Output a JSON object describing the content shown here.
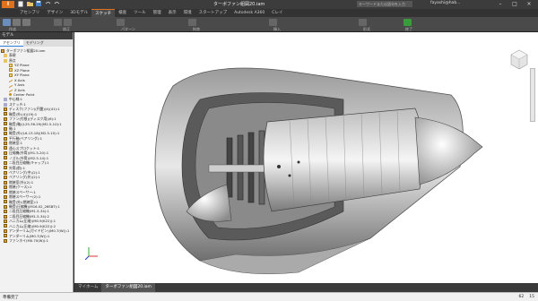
{
  "app": {
    "logo": "I",
    "window_title": "ターボファン組図20.iam",
    "search_placeholder": "キーワードまたは語句を入力",
    "user": "fayashi@hab..."
  },
  "ribbon": {
    "file_tab": "ファイル",
    "tabs": [
      "アセンブリ",
      "デザイン",
      "3Dモデル",
      "スケッチ",
      "検査",
      "ツール",
      "管理",
      "表示",
      "環境",
      "スタートアップ",
      "Autodesk A360",
      "Cレイ"
    ],
    "active_tab": "スケッチ",
    "groups": [
      "作成",
      "修正",
      "パターン",
      "拘束",
      "挿入",
      "形式",
      "終了"
    ]
  },
  "browser": {
    "header": "モデル",
    "tabs": [
      "アセンブリ",
      "モデリング"
    ],
    "items": [
      "ターボファン組図20.iam",
      "表現",
      "原点",
      "YZ Plane",
      "XZ Plane",
      "XY Plane",
      "X Axis",
      "Y Axis",
      "Z Axis",
      "Center Point",
      "中心線:1",
      "スケッチ:1",
      "ディスク(ファン)(円盤)(4)(41):1",
      "軸受(外)(4)(19):1",
      "ファン(付根)(ディスク用)(6):1",
      "軸受(軸)(L25-36.29)(M2.5-10):1",
      "軸:1",
      "軸受(外)(L6-13.18)(M2.5-10):1",
      "平行軸(ベアリング):1",
      "燃焼室:1",
      "遠心スプロケット:1",
      "圧縮機(外筒)(M1.5-20):1",
      "ノズル(外筒)(M2.5-14):1",
      "二段目圧縮機(キャップ):1",
      "外筒(前):1",
      "ベアリング(中)(2):1",
      "ベアリング(外)(2):1",
      "燃焼室(外)(2):1",
      "燃焼(ケース):1",
      "燃焼スペーサー:1",
      "燃焼スペーサー(2):1",
      "軸受(外)(燃焼室):1",
      "軸受(圧縮機)(M16.02_26SBT):1",
      "二段目圧縮機(M1.5-34):1",
      "二段目圧縮機(M1.5-34):2",
      "ハニカム(圧縮)(M0.9(K22)):1",
      "ハニカム(圧縮)(M0.9(K22)):2",
      "アンダーリム(ガイドピン)(M0.7(W)):1",
      "アンダーリム(M0.7(W)):1",
      "ファンホイ(M0.70(W)):1"
    ]
  },
  "doc_tabs": [
    "マイホーム",
    "ターボファン組図20.iam"
  ],
  "viewcube": {
    "face": "前"
  },
  "status": {
    "text": "準備完了",
    "count1": "62",
    "count2": "15"
  },
  "colors": {
    "accent": "#e2711d",
    "ribbon": "#4a4a4a",
    "panel": "#f2f2f2"
  }
}
